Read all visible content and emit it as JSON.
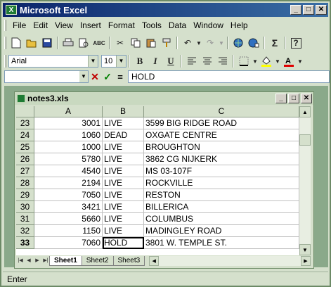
{
  "window": {
    "title": "Microsoft Excel",
    "icon": "excel-icon"
  },
  "window_buttons": {
    "minimize": "_",
    "maximize": "□",
    "close": "✕"
  },
  "menu": [
    "File",
    "Edit",
    "View",
    "Insert",
    "Format",
    "Tools",
    "Data",
    "Window",
    "Help"
  ],
  "toolbar": {
    "font_name": "Arial",
    "font_size": "10",
    "bold": "B",
    "italic": "I",
    "underline": "U",
    "sum": "Σ",
    "help": "?"
  },
  "formula_bar": {
    "name_box": "",
    "cancel": "✕",
    "enter": "✓",
    "equals": "=",
    "content": "HOLD"
  },
  "document": {
    "title": "notes3.xls",
    "columns": [
      "A",
      "B",
      "C"
    ],
    "rows": [
      {
        "num": "23",
        "a": "3001",
        "b": "LIVE",
        "c": "3599 BIG RIDGE ROAD"
      },
      {
        "num": "24",
        "a": "1060",
        "b": "DEAD",
        "c": "OXGATE CENTRE"
      },
      {
        "num": "25",
        "a": "1000",
        "b": "LIVE",
        "c": "BROUGHTON"
      },
      {
        "num": "26",
        "a": "5780",
        "b": "LIVE",
        "c": "3862 CG NIJKERK"
      },
      {
        "num": "27",
        "a": "4540",
        "b": "LIVE",
        "c": "MS  03-107F"
      },
      {
        "num": "28",
        "a": "2194",
        "b": "LIVE",
        "c": "ROCKVILLE"
      },
      {
        "num": "29",
        "a": "7050",
        "b": "LIVE",
        "c": "RESTON"
      },
      {
        "num": "30",
        "a": "3421",
        "b": "LIVE",
        "c": "BILLERICA"
      },
      {
        "num": "31",
        "a": "5660",
        "b": "LIVE",
        "c": "COLUMBUS"
      },
      {
        "num": "32",
        "a": "1150",
        "b": "LIVE",
        "c": "MADINGLEY ROAD"
      },
      {
        "num": "33",
        "a": "7060",
        "b": "HOLD",
        "c": "3801 W. TEMPLE ST."
      }
    ],
    "sheets": [
      "Sheet1",
      "Sheet2",
      "Sheet3"
    ],
    "active_sheet": "Sheet1"
  },
  "status": {
    "mode": "Enter"
  }
}
